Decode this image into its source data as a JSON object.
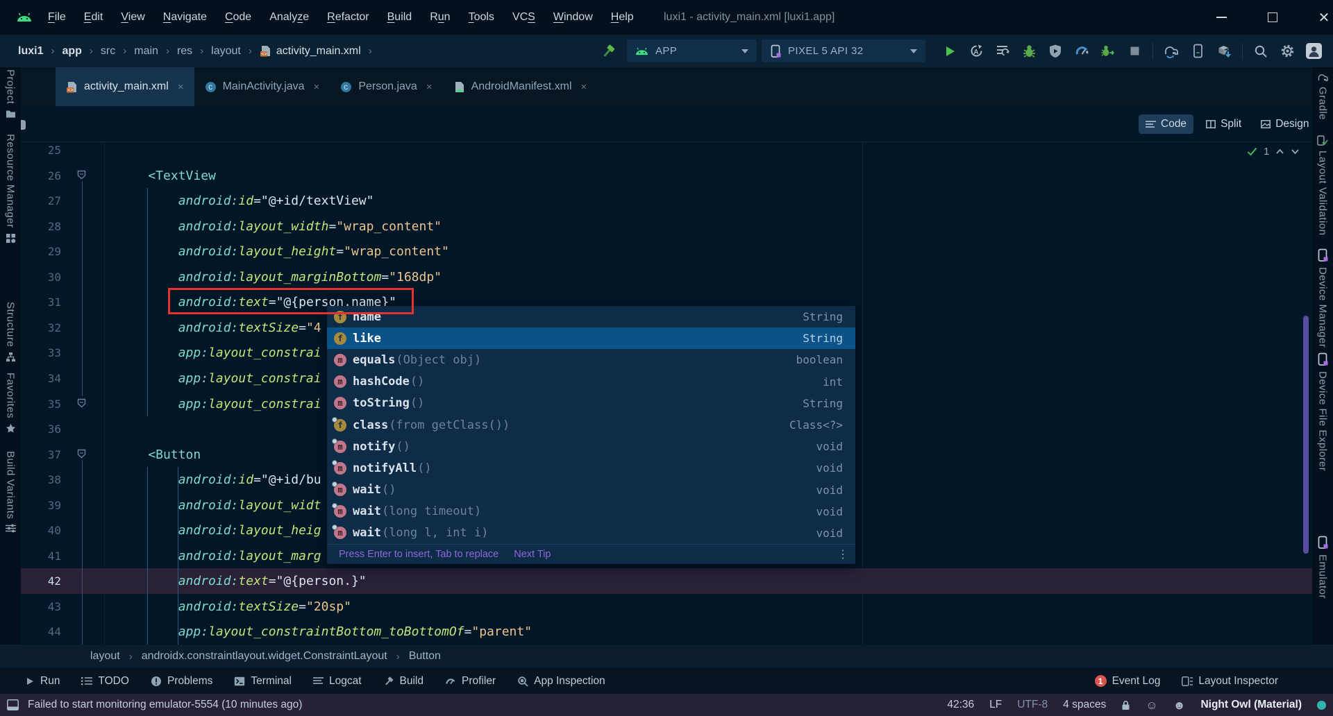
{
  "window": {
    "title": "luxi1 - activity_main.xml [luxi1.app]"
  },
  "menu": {
    "items": [
      {
        "label": "File",
        "u": 0
      },
      {
        "label": "Edit",
        "u": 0
      },
      {
        "label": "View",
        "u": 0
      },
      {
        "label": "Navigate",
        "u": 0
      },
      {
        "label": "Code",
        "u": 0
      },
      {
        "label": "Analyze",
        "u": 5
      },
      {
        "label": "Refactor",
        "u": 0
      },
      {
        "label": "Build",
        "u": 0
      },
      {
        "label": "Run",
        "u": 1
      },
      {
        "label": "Tools",
        "u": 0
      },
      {
        "label": "VCS",
        "u": 2
      },
      {
        "label": "Window",
        "u": 0
      },
      {
        "label": "Help",
        "u": 0
      }
    ]
  },
  "toolbar": {
    "breadcrumbs": [
      "luxi1",
      "app",
      "src",
      "main",
      "res",
      "layout",
      "activity_main.xml"
    ],
    "crumb_separator": "›",
    "run_config": "APP",
    "device": "PIXEL 5 API 32",
    "actions": [
      "run",
      "apply-changes",
      "apply-code-changes",
      "debug",
      "attach-profiler",
      "profiler",
      "attach-debugger",
      "stop",
      "divider",
      "gradle-sync",
      "device-manager",
      "sdk-manager",
      "divider",
      "search-everywhere",
      "settings",
      "profile-avatar"
    ]
  },
  "tabs": [
    {
      "label": "activity_main.xml",
      "icon": "xml-file",
      "active": true
    },
    {
      "label": "MainActivity.java",
      "icon": "java-class",
      "active": false
    },
    {
      "label": "Person.java",
      "icon": "java-class",
      "active": false
    },
    {
      "label": "AndroidManifest.xml",
      "icon": "manifest-file",
      "active": false
    }
  ],
  "view_modes": [
    {
      "label": "Code",
      "icon": "code",
      "active": true
    },
    {
      "label": "Split",
      "icon": "split",
      "active": false
    },
    {
      "label": "Design",
      "icon": "design",
      "active": false
    }
  ],
  "stripes": {
    "left": [
      {
        "label": "Project",
        "icon": "project-folder"
      },
      {
        "label": "Resource Manager",
        "icon": "resource-grid"
      },
      {
        "label": "Structure",
        "icon": "structure-tree"
      },
      {
        "label": "Favorites",
        "icon": "star"
      },
      {
        "label": "Build Variants",
        "icon": "variants-sliders"
      }
    ],
    "right": [
      {
        "label": "Gradle",
        "icon": "gradle-elephant"
      },
      {
        "label": "Layout Validation",
        "icon": "layout-validation"
      },
      {
        "label": "Device Manager",
        "icon": "phone"
      },
      {
        "label": "Device File Explorer",
        "icon": "phone"
      },
      {
        "label": "Emulator",
        "icon": "phone"
      }
    ]
  },
  "editor": {
    "inspection_count": "1",
    "lines": [
      {
        "n": 25,
        "tokens": []
      },
      {
        "n": 26,
        "fold": true,
        "tokens": [
          [
            "tag",
            "    <TextView"
          ]
        ]
      },
      {
        "n": 27,
        "tokens": [
          [
            "ns",
            "        android:"
          ],
          [
            "attr",
            "id"
          ],
          [
            "eq",
            "="
          ],
          [
            "ref",
            "\"@+id/textView\""
          ]
        ]
      },
      {
        "n": 28,
        "tokens": [
          [
            "ns",
            "        android:"
          ],
          [
            "attr",
            "layout_width"
          ],
          [
            "eq",
            "="
          ],
          [
            "str",
            "\"wrap_content\""
          ]
        ]
      },
      {
        "n": 29,
        "tokens": [
          [
            "ns",
            "        android:"
          ],
          [
            "attr",
            "layout_height"
          ],
          [
            "eq",
            "="
          ],
          [
            "str",
            "\"wrap_content\""
          ]
        ]
      },
      {
        "n": 30,
        "tokens": [
          [
            "ns",
            "        android:"
          ],
          [
            "attr",
            "layout_marginBottom"
          ],
          [
            "eq",
            "="
          ],
          [
            "str",
            "\"168dp\""
          ]
        ]
      },
      {
        "n": 31,
        "red": true,
        "tokens": [
          [
            "ns",
            "        android:"
          ],
          [
            "attr",
            "text"
          ],
          [
            "eq",
            "="
          ],
          [
            "ref",
            "\"@{person.name}\""
          ]
        ]
      },
      {
        "n": 32,
        "tokens": [
          [
            "ns",
            "        android:"
          ],
          [
            "attr",
            "textSize"
          ],
          [
            "eq",
            "="
          ],
          [
            "str",
            "\"4"
          ]
        ]
      },
      {
        "n": 33,
        "tokens": [
          [
            "ns",
            "        app:"
          ],
          [
            "attr",
            "layout_constrai"
          ]
        ]
      },
      {
        "n": 34,
        "tokens": [
          [
            "ns",
            "        app:"
          ],
          [
            "attr",
            "layout_constrai"
          ]
        ]
      },
      {
        "n": 35,
        "fold": true,
        "tokens": [
          [
            "ns",
            "        app:"
          ],
          [
            "attr",
            "layout_constrai"
          ]
        ]
      },
      {
        "n": 36,
        "tokens": []
      },
      {
        "n": 37,
        "fold": true,
        "tokens": [
          [
            "tag",
            "    <Button"
          ]
        ]
      },
      {
        "n": 38,
        "tokens": [
          [
            "ns",
            "        android:"
          ],
          [
            "attr",
            "id"
          ],
          [
            "eq",
            "="
          ],
          [
            "ref",
            "\"@+id/bu"
          ]
        ]
      },
      {
        "n": 39,
        "tokens": [
          [
            "ns",
            "        android:"
          ],
          [
            "attr",
            "layout_widt"
          ]
        ]
      },
      {
        "n": 40,
        "tokens": [
          [
            "ns",
            "        android:"
          ],
          [
            "attr",
            "layout_heig"
          ]
        ]
      },
      {
        "n": 41,
        "tokens": [
          [
            "ns",
            "        android:"
          ],
          [
            "attr",
            "layout_marg"
          ]
        ]
      },
      {
        "n": 42,
        "current": true,
        "tokens": [
          [
            "ns",
            "        android:"
          ],
          [
            "attr",
            "text"
          ],
          [
            "eq",
            "="
          ],
          [
            "ref",
            "\"@{person.}\""
          ]
        ]
      },
      {
        "n": 43,
        "tokens": [
          [
            "ns",
            "        android:"
          ],
          [
            "attr",
            "textSize"
          ],
          [
            "eq",
            "="
          ],
          [
            "str",
            "\"20sp\""
          ]
        ]
      },
      {
        "n": 44,
        "tokens": [
          [
            "ns",
            "        app:"
          ],
          [
            "attr",
            "layout_constraintBottom_toBottomOf"
          ],
          [
            "eq",
            "="
          ],
          [
            "str",
            "\"parent\""
          ]
        ]
      }
    ]
  },
  "popup": {
    "items": [
      {
        "kind": "f",
        "name": "name",
        "params": "",
        "type": "String",
        "locked": false,
        "selected": false
      },
      {
        "kind": "f",
        "name": "like",
        "params": "",
        "type": "String",
        "locked": false,
        "selected": true
      },
      {
        "kind": "m",
        "name": "equals",
        "params": "(Object obj)",
        "type": "boolean",
        "locked": false,
        "selected": false
      },
      {
        "kind": "m",
        "name": "hashCode",
        "params": "()",
        "type": "int",
        "locked": false,
        "selected": false
      },
      {
        "kind": "m",
        "name": "toString",
        "params": "()",
        "type": "String",
        "locked": false,
        "selected": false
      },
      {
        "kind": "f",
        "name": "class",
        "params": " (from getClass())",
        "type": "Class<?>",
        "locked": true,
        "selected": false
      },
      {
        "kind": "m",
        "name": "notify",
        "params": "()",
        "type": "void",
        "locked": true,
        "selected": false
      },
      {
        "kind": "m",
        "name": "notifyAll",
        "params": "()",
        "type": "void",
        "locked": true,
        "selected": false
      },
      {
        "kind": "m",
        "name": "wait",
        "params": "()",
        "type": "void",
        "locked": true,
        "selected": false
      },
      {
        "kind": "m",
        "name": "wait",
        "params": "(long timeout)",
        "type": "void",
        "locked": true,
        "selected": false
      },
      {
        "kind": "m",
        "name": "wait",
        "params": "(long l, int i)",
        "type": "void",
        "locked": true,
        "selected": false
      }
    ],
    "hint": "Press Enter to insert, Tab to replace",
    "hint_action": "Next Tip",
    "more_glyph": "⋮"
  },
  "breadcrumbs_bottom": [
    "layout",
    "androidx.constraintlayout.widget.ConstraintLayout",
    "Button"
  ],
  "tool_windows": {
    "left": [
      {
        "label": "Run",
        "icon": "play-outline"
      },
      {
        "label": "TODO",
        "icon": "todo-list"
      },
      {
        "label": "Problems",
        "icon": "problems-circle"
      },
      {
        "label": "Terminal",
        "icon": "terminal"
      },
      {
        "label": "Logcat",
        "icon": "logcat-lines"
      },
      {
        "label": "Build",
        "icon": "build-hammer"
      },
      {
        "label": "Profiler",
        "icon": "profiler-gauge"
      },
      {
        "label": "App Inspection",
        "icon": "app-inspection"
      }
    ],
    "right": [
      {
        "label": "Event Log",
        "icon": "event-log",
        "badge": "1"
      },
      {
        "label": "Layout Inspector",
        "icon": "layout-inspector"
      }
    ]
  },
  "status": {
    "message": "Failed to start monitoring emulator-5554 (10 minutes ago)",
    "caret": "42:36",
    "line_ending": "LF",
    "encoding": "UTF-8",
    "indent": "4 spaces",
    "theme": "Night Owl (Material)"
  },
  "colors": {
    "annotation_red": "#e5342c",
    "completion_selection": "#0a5287",
    "status_bar_plum": "#272138",
    "android_green": "#3ddc84"
  }
}
